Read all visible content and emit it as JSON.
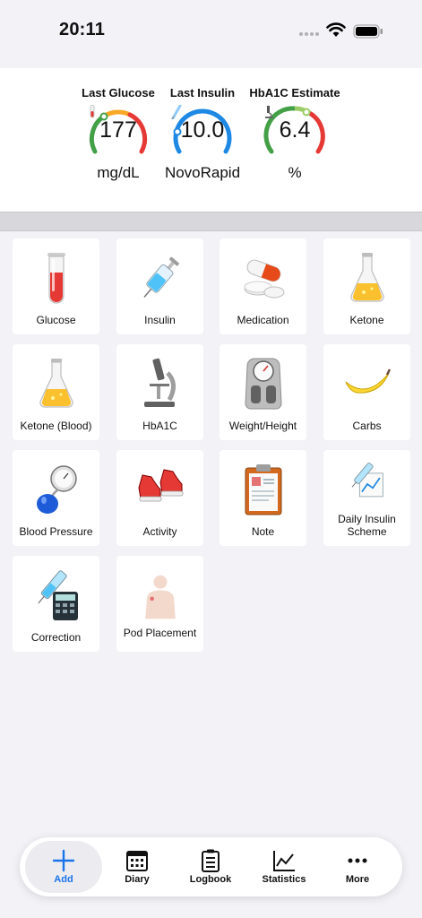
{
  "status_bar": {
    "time": "20:11"
  },
  "summary": {
    "glucose": {
      "title": "Last Glucose",
      "value": "177",
      "unit": "mg/dL"
    },
    "insulin": {
      "title": "Last Insulin",
      "value": "10.0",
      "unit": "NovoRapid"
    },
    "hba1c": {
      "title": "HbA1C Estimate",
      "value": "6.4",
      "unit": "%"
    }
  },
  "tiles": [
    {
      "label": "Glucose",
      "icon": "test-tube-icon"
    },
    {
      "label": "Insulin",
      "icon": "syringe-icon"
    },
    {
      "label": "Medication",
      "icon": "pills-icon"
    },
    {
      "label": "Ketone",
      "icon": "flask-icon"
    },
    {
      "label": "Ketone (Blood)",
      "icon": "flask-icon"
    },
    {
      "label": "HbA1C",
      "icon": "microscope-icon"
    },
    {
      "label": "Weight/Height",
      "icon": "scale-icon"
    },
    {
      "label": "Carbs",
      "icon": "banana-icon"
    },
    {
      "label": "Blood Pressure",
      "icon": "blood-pressure-icon"
    },
    {
      "label": "Activity",
      "icon": "sneakers-icon"
    },
    {
      "label": "Note",
      "icon": "clipboard-icon"
    },
    {
      "label": "Daily Insulin Scheme",
      "icon": "insulin-scheme-icon"
    },
    {
      "label": "Correction",
      "icon": "calculator-icon"
    },
    {
      "label": "Pod Placement",
      "icon": "body-icon"
    }
  ],
  "tabs": [
    {
      "label": "Add",
      "icon": "plus-icon",
      "active": true
    },
    {
      "label": "Diary",
      "icon": "calendar-icon"
    },
    {
      "label": "Logbook",
      "icon": "clipboard-list-icon"
    },
    {
      "label": "Statistics",
      "icon": "chart-icon"
    },
    {
      "label": "More",
      "icon": "more-icon"
    }
  ],
  "colors": {
    "accent": "#1a73e8",
    "gauge_red": "#e53935",
    "gauge_green": "#43a047",
    "gauge_blue": "#1e88e5"
  }
}
